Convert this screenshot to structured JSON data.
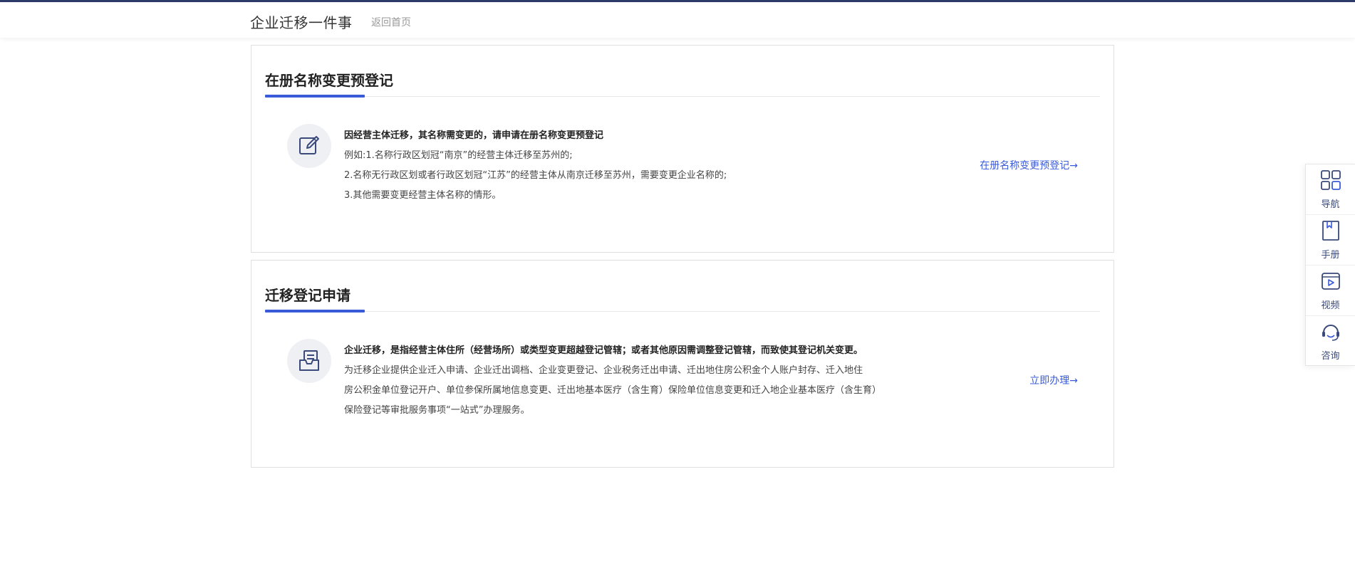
{
  "header": {
    "title": "企业迁移一件事",
    "back_home": "返回首页"
  },
  "cards": [
    {
      "title": "在册名称变更预登记",
      "lead": "因经营主体迁移，其名称需变更的，请申请在册名称变更预登记",
      "lines": [
        "例如:1.名称行政区划冠“南京”的经营主体迁移至苏州的;",
        "2.名称无行政区划或者行政区划冠“江苏”的经营主体从南京迁移至苏州，需要变更企业名称的;",
        "3.其他需要变更经营主体名称的情形。"
      ],
      "action": "在册名称变更预登记→",
      "icon": "edit-icon"
    },
    {
      "title": "迁移登记申请",
      "lead": "企业迁移，是指经营主体住所（经营场所）或类型变更超越登记管辖；或者其他原因需调整登记管辖，而致使其登记机关变更。",
      "lines": [
        "为迁移企业提供企业迁入申请、企业迁出调档、企业变更登记、企业税务迁出申请、迁出地住房公积金个人账户封存、迁入地住",
        "房公积金单位登记开户、单位参保所属地信息变更、迁出地基本医疗（含生育）保险单位信息变更和迁入地企业基本医疗（含生育）",
        "保险登记等审批服务事项“一站式”办理服务。"
      ],
      "action": "立即办理→",
      "icon": "document-tray-icon"
    }
  ],
  "side_panel": [
    {
      "label": "导航",
      "icon": "grid-icon"
    },
    {
      "label": "手册",
      "icon": "bookmark-book-icon"
    },
    {
      "label": "视频",
      "icon": "video-play-icon"
    },
    {
      "label": "咨询",
      "icon": "headset-icon"
    }
  ],
  "colors": {
    "accent": "#3a5bd9",
    "top_border": "#2b3a67",
    "icon": "#3a4a7a"
  }
}
